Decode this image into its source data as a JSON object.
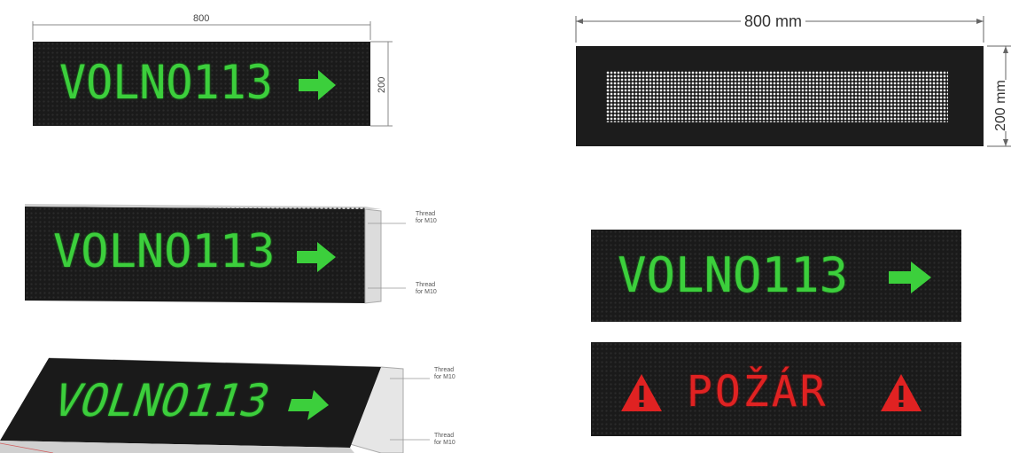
{
  "dimensions": {
    "top_left_width": "800",
    "top_left_height": "200",
    "top_right_width": "800 mm",
    "top_right_height": "200 mm"
  },
  "signs": {
    "free_spaces_text": "VOLNO113",
    "fire_text": "POŽÁR",
    "arrow_icon": "arrow-right-icon",
    "warning_icon": "warning-triangle-icon"
  },
  "mounting_labels": {
    "side_top": "Thread\nfor M10",
    "side_bottom": "Thread\nfor M10",
    "angled_top": "Thread\nfor M10",
    "angled_bottom": "Thread\nfor M10"
  },
  "colors": {
    "led_green": "#3ccf3c",
    "led_red": "#e02222",
    "led_white": "#f2f2f2",
    "panel_black": "#1a1a1a"
  }
}
